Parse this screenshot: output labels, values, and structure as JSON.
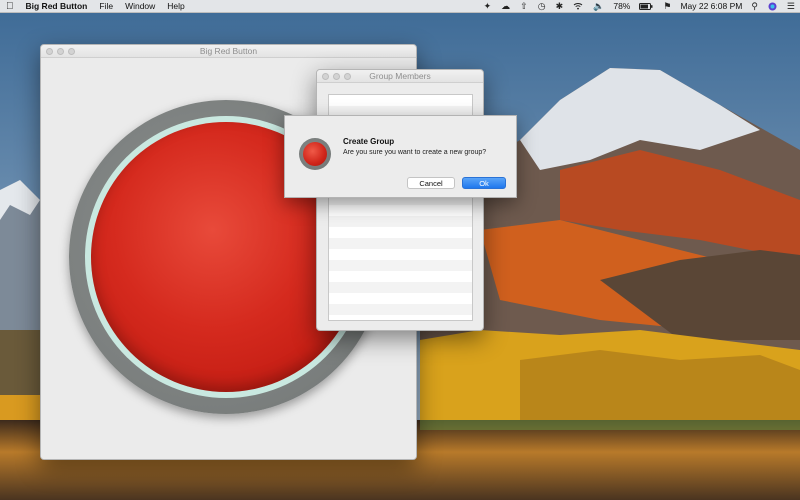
{
  "menubar": {
    "apple_icon": "apple-icon",
    "app_name": "Big Red Button",
    "menus": [
      "File",
      "Window",
      "Help"
    ],
    "battery": "78%",
    "clock": "May 22  6:08 PM"
  },
  "main_window": {
    "title": "Big Red Button"
  },
  "group_window": {
    "title": "Group Members"
  },
  "alert": {
    "title": "Create Group",
    "message": "Are you sure you want to create a new group?",
    "cancel_label": "Cancel",
    "ok_label": "Ok"
  },
  "colors": {
    "button_red": "#d52a1e",
    "ring_mint": "#c9e8e0",
    "default_blue": "#1f78ee"
  }
}
